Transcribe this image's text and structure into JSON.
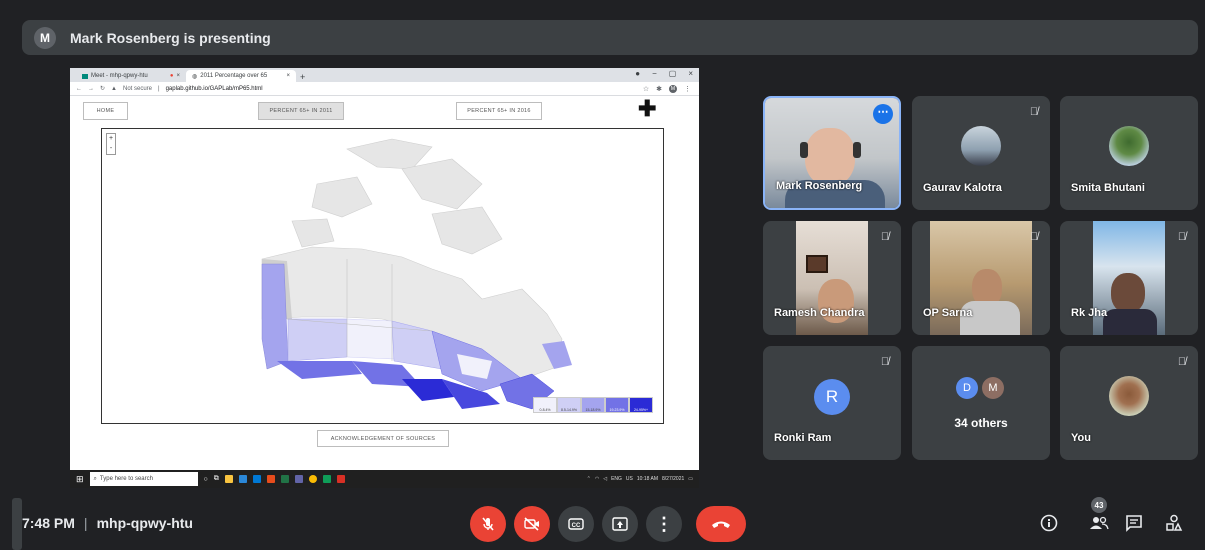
{
  "presenting": {
    "avatar_letter": "M",
    "text": "Mark Rosenberg is presenting"
  },
  "shared_screen": {
    "tabs": [
      {
        "label": "Meet - mhp-qpwy-htu"
      },
      {
        "label": "2011 Percentage over 65"
      }
    ],
    "address": {
      "security": "Not secure",
      "url": "gaplab.github.io/GAPLab/mP65.html",
      "profile": "M"
    },
    "page": {
      "home": "HOME",
      "btn_2011": "PERCENT 65+ IN 2011",
      "btn_2016": "PERCENT 65+ IN 2016",
      "ack": "ACKNOWLEDGEMENT OF SOURCES",
      "zoom_in": "+",
      "zoom_out": "-",
      "legend": [
        "0-8.4%",
        "8.5-14.9%",
        "15-18.9%",
        "19-23.9%",
        "24-95%+"
      ],
      "legend_colors": [
        "#f1f1fb",
        "#cfcff5",
        "#a4a4ee",
        "#7272e6",
        "#2b2bd6"
      ]
    },
    "taskbar": {
      "search": "Type here to search",
      "lang": "ENG",
      "region": "US",
      "time": "10:18 AM",
      "date": "8/27/2021"
    }
  },
  "participants": [
    {
      "name": "Mark Rosenberg",
      "muted": false,
      "pinned": true
    },
    {
      "name": "Gaurav Kalotra",
      "muted": true
    },
    {
      "name": "Smita Bhutani",
      "muted": false
    },
    {
      "name": "Ramesh Chandra",
      "muted": true
    },
    {
      "name": "OP Sarna",
      "muted": true
    },
    {
      "name": "Rk Jha",
      "muted": true
    },
    {
      "name": "Ronki Ram",
      "muted": true,
      "avatar_letter": "R"
    },
    {
      "name": "34 others",
      "initials": [
        "D",
        "M"
      ]
    },
    {
      "name": "You",
      "muted": true
    }
  ],
  "bottom": {
    "time": "7:48 PM",
    "meeting_code": "mhp-qpwy-htu",
    "people_count": "43"
  },
  "colors": {
    "bg": "#202124",
    "tile": "#3c4043",
    "red": "#ea4335",
    "accent": "#8ab4f8"
  }
}
